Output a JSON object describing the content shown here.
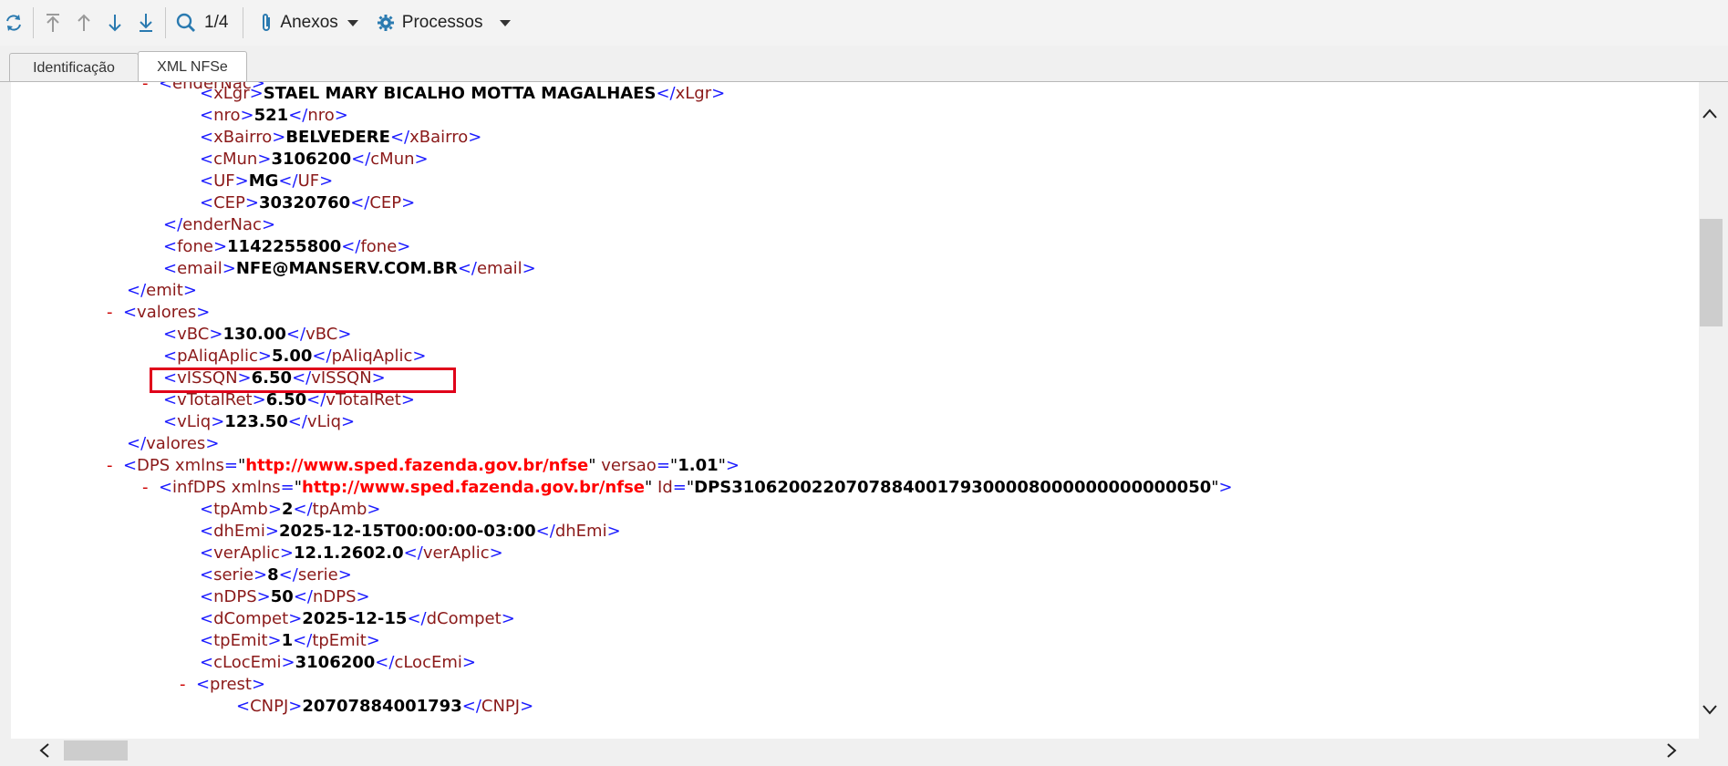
{
  "toolbar": {
    "refresh_icon": "refresh-icon",
    "first_icon": "arrow-first-icon",
    "up_icon": "arrow-up-icon",
    "down_icon": "arrow-down-icon",
    "last_icon": "arrow-last-icon",
    "search_icon": "search-icon",
    "counter": "1/4",
    "attachments_label": "Anexos",
    "processes_label": "Processos"
  },
  "tabs": [
    {
      "label": "Identificação",
      "active": false
    },
    {
      "label": "XML NFSe",
      "active": true
    }
  ],
  "xml": {
    "l1_tag": "enderNac",
    "xLgr_tag": "xLgr",
    "xLgr_val": "STAEL MARY BICALHO MOTTA MAGALHAES",
    "nro_tag": "nro",
    "nro_val": "521",
    "xBairro_tag": "xBairro",
    "xBairro_val": "BELVEDERE",
    "cMun_tag": "cMun",
    "cMun_val": "3106200",
    "UF_tag": "UF",
    "UF_val": "MG",
    "CEP_tag": "CEP",
    "CEP_val": "30320760",
    "enderNac_close": "enderNac",
    "fone_tag": "fone",
    "fone_val": "1142255800",
    "email_tag": "email",
    "email_val": "NFE@MANSERV.COM.BR",
    "emit_close": "emit",
    "valores_tag": "valores",
    "vBC_tag": "vBC",
    "vBC_val": "130.00",
    "pAliqAplic_tag": "pAliqAplic",
    "pAliqAplic_val": "5.00",
    "vISSQN_tag": "vISSQN",
    "vISSQN_val": "6.50",
    "vTotalRet_tag": "vTotalRet",
    "vTotalRet_val": "6.50",
    "vLiq_tag": "vLiq",
    "vLiq_val": "123.50",
    "valores_close": "valores",
    "DPS_tag": "DPS",
    "DPS_xmlns_attr": "xmlns",
    "DPS_xmlns_val": "http://www.sped.fazenda.gov.br/nfse",
    "DPS_versao_attr": "versao",
    "DPS_versao_val": "1.01",
    "infDPS_tag": "infDPS",
    "infDPS_xmlns_attr": "xmlns",
    "infDPS_xmlns_val": "http://www.sped.fazenda.gov.br/nfse",
    "infDPS_id_attr": "Id",
    "infDPS_id_val": "DPS310620022070788400179300008000000000000050",
    "tpAmb_tag": "tpAmb",
    "tpAmb_val": "2",
    "dhEmi_tag": "dhEmi",
    "dhEmi_val": "2025-12-15T00:00:00-03:00",
    "verAplic_tag": "verAplic",
    "verAplic_val": "12.1.2602.0",
    "serie_tag": "serie",
    "serie_val": "8",
    "nDPS_tag": "nDPS",
    "nDPS_val": "50",
    "dCompet_tag": "dCompet",
    "dCompet_val": "2025-12-15",
    "tpEmit_tag": "tpEmit",
    "tpEmit_val": "1",
    "cLocEmi_tag": "cLocEmi",
    "cLocEmi_val": "3106200",
    "prest_tag": "prest",
    "CNPJ_tag": "CNPJ",
    "CNPJ_val": "20707884001793"
  },
  "scrollbars": {
    "up_icon": "chevron-up-icon",
    "down_icon": "chevron-down-icon",
    "left_icon": "chevron-left-icon",
    "right_icon": "chevron-right-icon"
  },
  "colors": {
    "tag_bracket": "#1a1aff",
    "tag_name": "#8b1a1a",
    "attr_value": "#ff0000",
    "collapse_minus": "#cc0000",
    "highlight_box": "#e0001a",
    "toolbar_icon": "#2a7ab0"
  }
}
